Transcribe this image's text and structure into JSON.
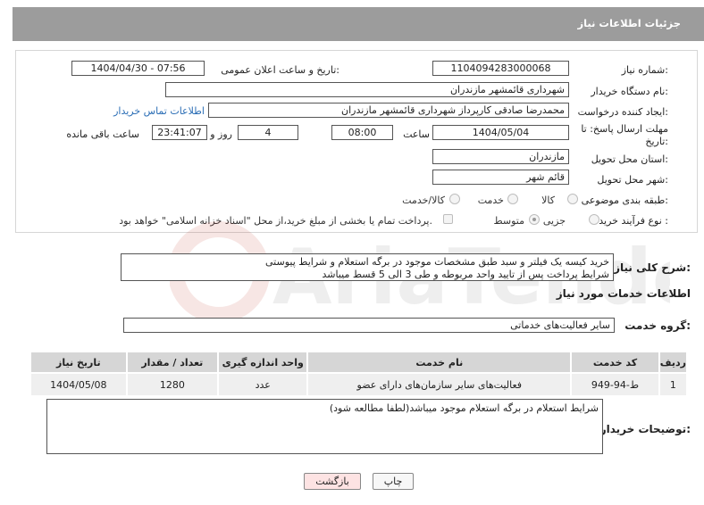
{
  "page": {
    "title": "جزئیات اطلاعات نیاز"
  },
  "form": {
    "need_number_label": "شماره نیاز:",
    "need_number": "1104094283000068",
    "announce_label": "تاریخ و ساعت اعلان عمومی:",
    "announce_value": "1404/04/30 - 07:56",
    "buyer_org_label": "نام دستگاه خریدار:",
    "buyer_org": "شهرداری قائمشهر مازندران",
    "creator_label": "ایجاد کننده درخواست:",
    "creator": "محمدرضا صادقی کارپرداز شهرداری قائمشهر مازندران",
    "contact_link": "اطلاعات تماس خریدار",
    "deadline_label_1": "مهلت ارسال پاسخ: تا",
    "deadline_label_2": "تاریخ:",
    "deadline_date": "1404/05/04",
    "time_label": "ساعت",
    "deadline_time": "08:00",
    "days_value": "4",
    "days_label": "روز و",
    "remaining_time": "23:41:07",
    "remaining_label": "ساعت باقی مانده",
    "province_label": "استان محل تحویل:",
    "province": "مازندران",
    "city_label": "شهر محل تحویل:",
    "city": "قائم شهر",
    "category_label": "طبقه بندی موضوعی:",
    "category_options": [
      "کالا",
      "خدمت",
      "کالا/خدمت"
    ],
    "category_selected": "خدمت",
    "process_label": "نوع فرآیند خرید :",
    "process_options": [
      "جزیی",
      "متوسط"
    ],
    "process_selected": "جزیی",
    "payment_note": "پرداخت تمام یا بخشی از مبلغ خرید،از محل \"اسناد خزانه اسلامی\" خواهد بود."
  },
  "description": {
    "label": "شرح کلی نیاز:",
    "text_line1": "خرید کیسه یک فیلتر و سبد طبق مشخصات موجود در برگه استعلام و شرایط پیوستی",
    "text_line2": "شرایط پرداخت پس از تایید واحد مربوطه و طی 3 الی 5 قسط میباشد"
  },
  "services": {
    "section_title": "اطلاعات خدمات مورد نیاز",
    "group_label": "گروه خدمت:",
    "group_value": "سایر فعالیت‌های خدماتی",
    "columns": [
      "ردیف",
      "کد خدمت",
      "نام خدمت",
      "واحد اندازه گیری",
      "تعداد / مقدار",
      "تاریخ نیاز"
    ],
    "rows": [
      [
        "1",
        "ط-94-949",
        "فعالیت‌های سایر سازمان‌های دارای عضو",
        "عدد",
        "1280",
        "1404/05/08"
      ]
    ]
  },
  "buyer_notes": {
    "label": "توضیحات خریدار:",
    "text": "شرایط استعلام در برگه استعلام موجود میباشد(لطفا مطالعه شود)"
  },
  "buttons": {
    "print": "چاپ",
    "back": "بازگشت"
  },
  "watermark": {
    "text": "AriaTender.net"
  }
}
